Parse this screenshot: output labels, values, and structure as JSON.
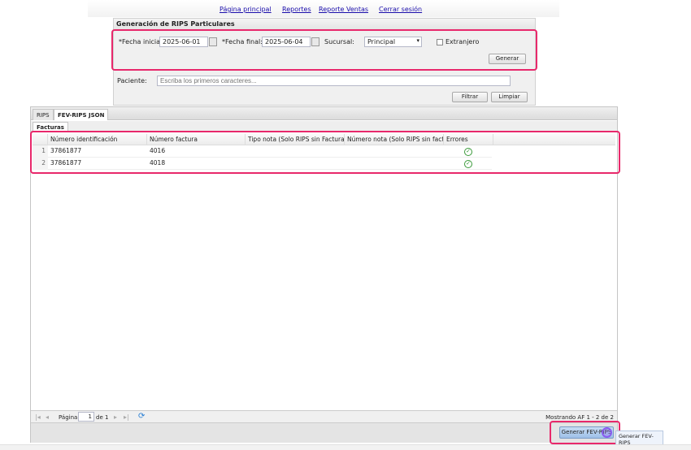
{
  "nav": {
    "links": [
      "Página principal",
      "Reportes",
      "Reporte Ventas",
      "Cerrar sesión"
    ]
  },
  "form": {
    "title": "Generación de RIPS Particulares",
    "fecha_inicial_label": "*Fecha inicial:",
    "fecha_inicial": "2025-06-01",
    "fecha_final_label": "*Fecha final:",
    "fecha_final": "2025-06-04",
    "sucursal_label": "Sucursal:",
    "sucursal": "Principal",
    "extranjero_label": "Extranjero",
    "extranjero_checked": false,
    "generar": "Generar",
    "paciente_label": "Paciente:",
    "paciente_placeholder": "Escriba los primeros caracteres...",
    "filtrar": "Filtrar",
    "limpiar": "Limpiar"
  },
  "tabs": {
    "items": [
      "RIPS",
      "FEV-RIPS JSON"
    ],
    "active": "FEV-RIPS JSON",
    "subtab": "Facturas"
  },
  "grid": {
    "columns": [
      "Número identificación",
      "Número factura",
      "Tipo nota (Solo RIPS sin Factura)",
      "Número nota (Solo RIPS sin factur...",
      "Errores"
    ],
    "rows": [
      {
        "n": "1",
        "id": "37861877",
        "factura": "4016",
        "errores": "ok"
      },
      {
        "n": "2",
        "id": "37861877",
        "factura": "4018",
        "errores": "ok"
      }
    ]
  },
  "pager": {
    "page_label": "Página",
    "page": "1",
    "of": "de 1",
    "status": "Mostrando AF 1 - 2 de 2"
  },
  "footer": {
    "button": "Generar FEV-RIPS",
    "tooltip": "Generar FEV-RIPS"
  },
  "colors": {
    "highlight": "#e8286b",
    "ok": "#3a9a3a"
  }
}
